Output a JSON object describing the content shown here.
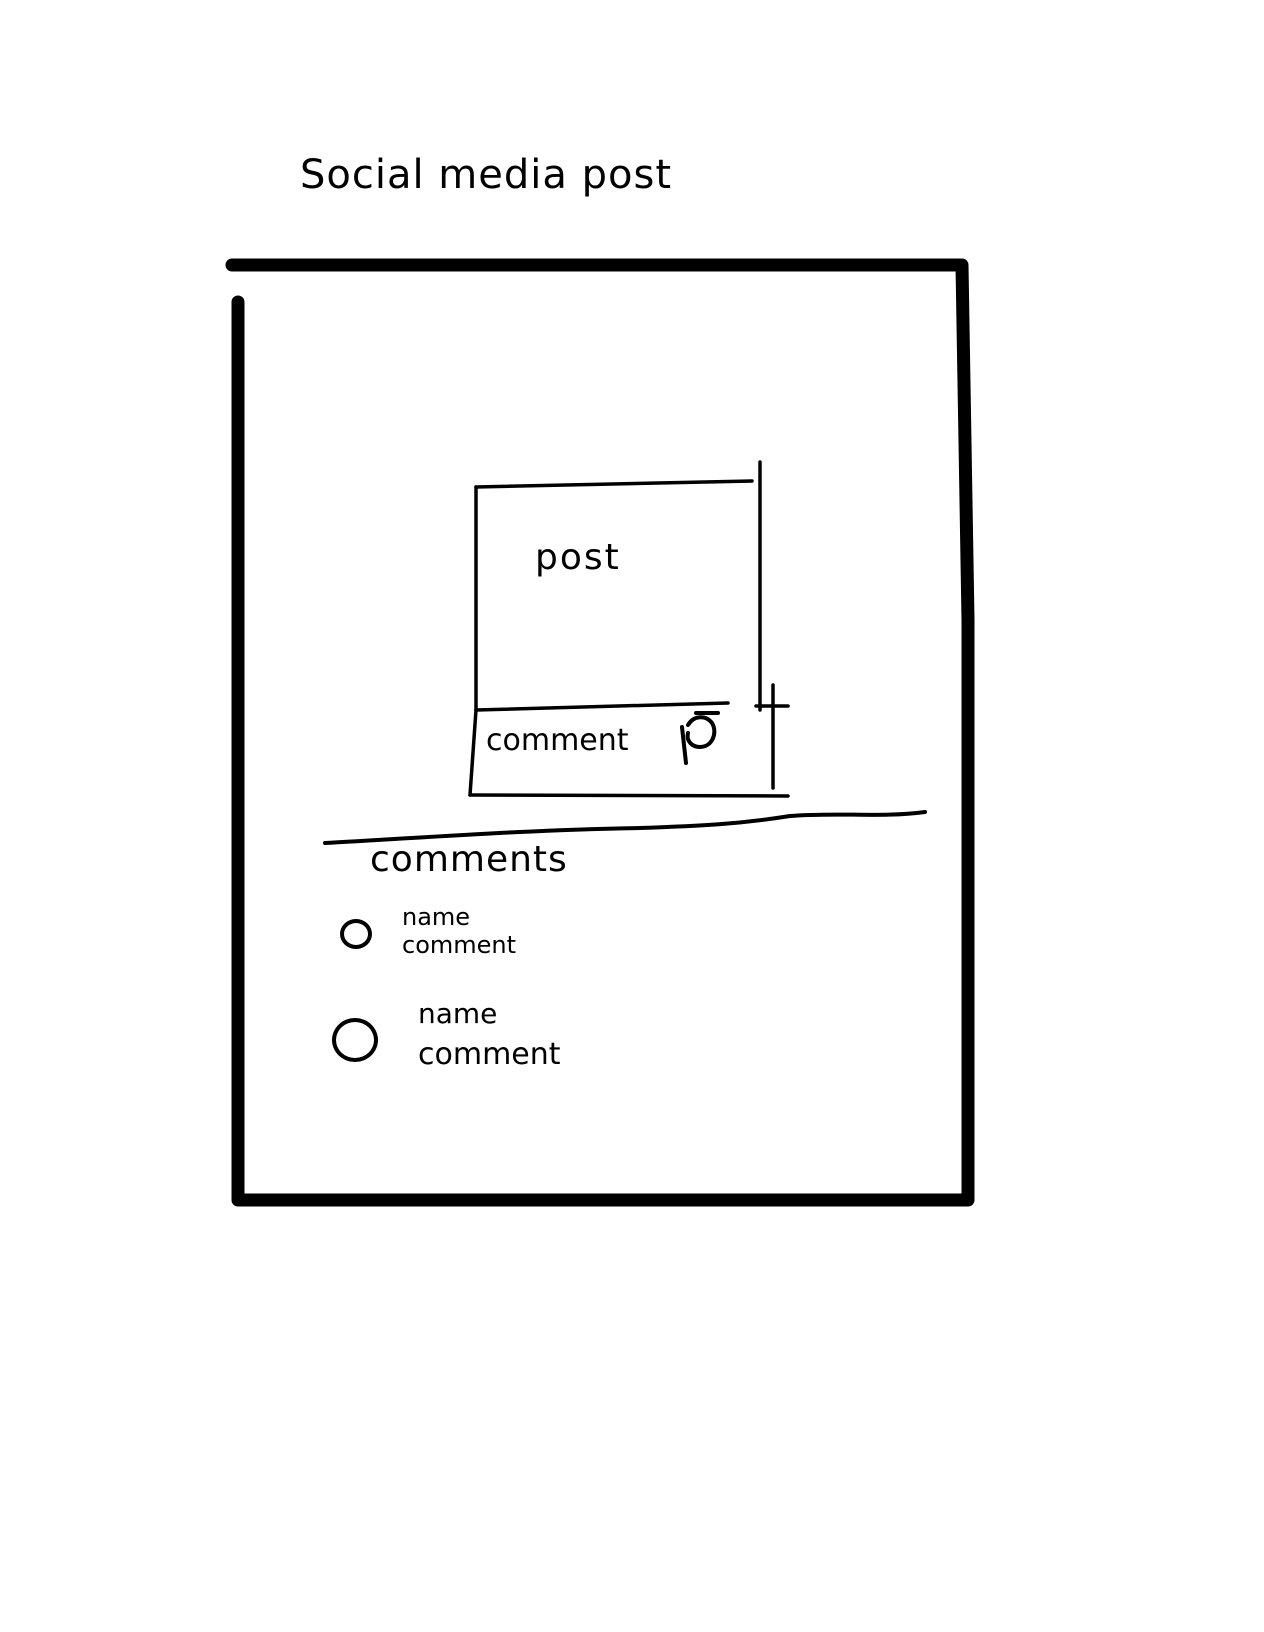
{
  "page": {
    "title": "Social media post"
  },
  "post": {
    "label": "post"
  },
  "comment_box": {
    "placeholder": "comment",
    "send_icon": "send-icon"
  },
  "comments_section": {
    "heading": "comments",
    "items": [
      {
        "name": "name",
        "text": "comment"
      },
      {
        "name": "name",
        "text": "comment"
      }
    ]
  },
  "colors": {
    "ink": "#000000",
    "background": "#ffffff"
  }
}
